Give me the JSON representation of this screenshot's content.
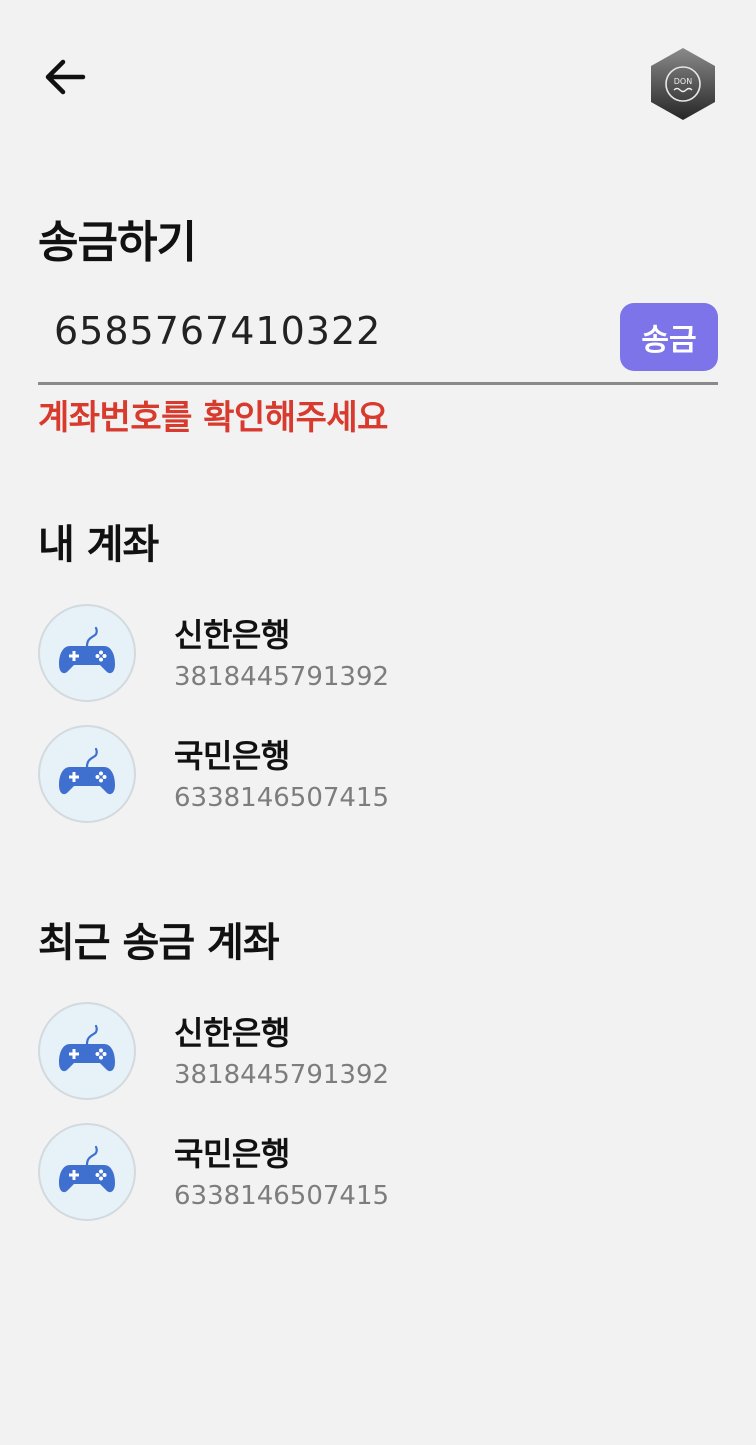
{
  "header": {
    "back_icon": "arrow-left-icon",
    "logo_text": "DON"
  },
  "transfer": {
    "title": "송금하기",
    "account_value": "6585767410322",
    "send_label": "송금",
    "error_message": "계좌번호를 확인해주세요"
  },
  "colors": {
    "accent": "#7c74e8",
    "error": "#d93a2e",
    "icon": "#3f6fcf",
    "avatar_bg": "#e6f1f8"
  },
  "my_accounts": {
    "title": "내 계좌",
    "items": [
      {
        "bank": "신한은행",
        "account": "3818445791392",
        "icon": "gamepad-icon"
      },
      {
        "bank": "국민은행",
        "account": "6338146507415",
        "icon": "gamepad-icon"
      }
    ]
  },
  "recent_accounts": {
    "title": "최근 송금 계좌",
    "items": [
      {
        "bank": "신한은행",
        "account": "3818445791392",
        "icon": "gamepad-icon"
      },
      {
        "bank": "국민은행",
        "account": "6338146507415",
        "icon": "gamepad-icon"
      }
    ]
  }
}
